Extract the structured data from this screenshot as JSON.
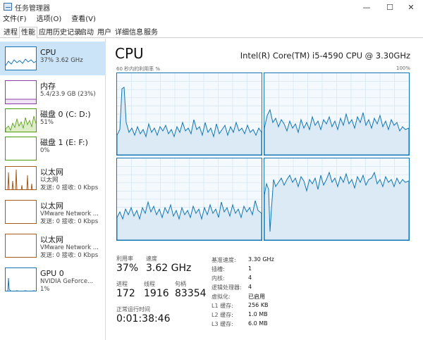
{
  "window": {
    "title": "任务管理器",
    "minimize_glyph": "—",
    "maximize_glyph": "☐",
    "close_glyph": "✕"
  },
  "menu": [
    "文件(F)",
    "选项(O)",
    "查看(V)"
  ],
  "tabs": [
    "进程",
    "性能",
    "应用历史记录",
    "启动",
    "用户",
    "详细信息",
    "服务"
  ],
  "active_tab": "性能",
  "sidebar": [
    {
      "title": "CPU",
      "sub1": "37% 3.62 GHz",
      "sub2": "",
      "kind": "cpu",
      "color": "#1176b3"
    },
    {
      "title": "内存",
      "sub1": "5.4/23.9 GB (23%)",
      "sub2": "",
      "kind": "memory",
      "color": "#8b3fa8"
    },
    {
      "title": "磁盘 0 (C: D:)",
      "sub1": "51%",
      "sub2": "",
      "kind": "disk0",
      "color": "#4e9a06"
    },
    {
      "title": "磁盘 1 (E: F:)",
      "sub1": "0%",
      "sub2": "",
      "kind": "disk1",
      "color": "#4e9a06"
    },
    {
      "title": "以太网",
      "sub1": "以太网",
      "sub2": "发送: 0 接收: 0 Kbps",
      "kind": "ethernet",
      "color": "#a85a1a"
    },
    {
      "title": "以太网",
      "sub1": "VMware Network ...",
      "sub2": "发送: 0 接收: 0 Kbps",
      "kind": "ethernet",
      "color": "#a85a1a"
    },
    {
      "title": "以太网",
      "sub1": "VMware Network ...",
      "sub2": "发送: 0 接收: 0 Kbps",
      "kind": "ethernet",
      "color": "#a85a1a"
    },
    {
      "title": "GPU 0",
      "sub1": "NVIDIA GeForce...",
      "sub2": "1%",
      "kind": "gpu",
      "color": "#1176b3"
    }
  ],
  "main": {
    "title": "CPU",
    "model": "Intel(R) Core(TM) i5-4590 CPU @ 3.30GHz",
    "graph_caption": "60 秒内的利用率 %",
    "graph_max": "100%",
    "colors": {
      "line": "#1176b3",
      "fill": "#dbeaf5",
      "grid": "#d3e4f1"
    }
  },
  "stats": {
    "utilization_label": "利用率",
    "utilization": "37%",
    "speed_label": "速度",
    "speed": "3.62 GHz",
    "processes_label": "进程",
    "processes": "172",
    "threads_label": "线程",
    "threads": "1916",
    "handles_label": "句柄",
    "handles": "83354",
    "uptime_label": "正常运行时间",
    "uptime": "0:01:38:46"
  },
  "specs": [
    {
      "label": "基准速度:",
      "value": "3.30 GHz"
    },
    {
      "label": "插槽:",
      "value": "1"
    },
    {
      "label": "内核:",
      "value": "4"
    },
    {
      "label": "逻辑处理器:",
      "value": "4"
    },
    {
      "label": "虚拟化:",
      "value": "已启用"
    },
    {
      "label": "L1 缓存:",
      "value": "256 KB"
    },
    {
      "label": "L2 缓存:",
      "value": "1.0 MB"
    },
    {
      "label": "L3 缓存:",
      "value": "6.0 MB"
    }
  ]
}
